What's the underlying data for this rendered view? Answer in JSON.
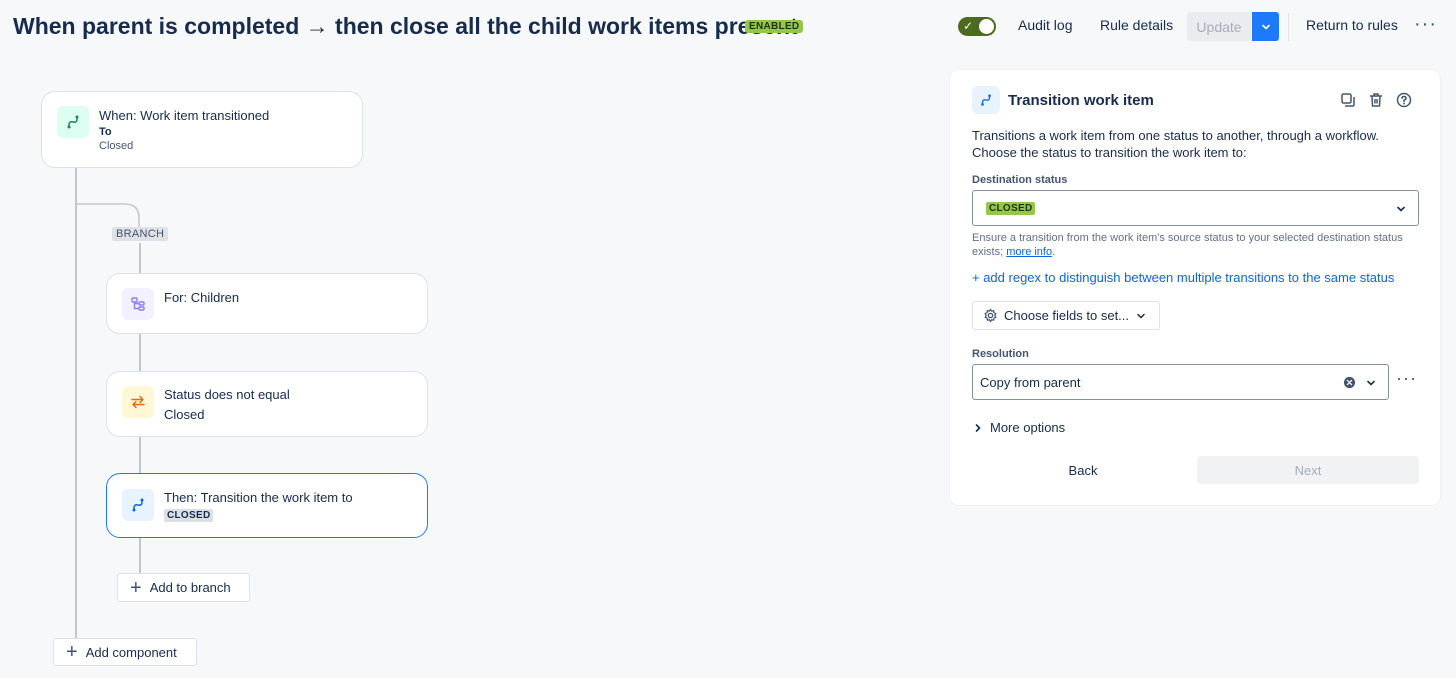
{
  "header": {
    "title": "When parent is completed → then close all the child work items present",
    "status_badge": "ENABLED",
    "audit_log": "Audit log",
    "rule_details": "Rule details",
    "update": "Update",
    "return_to_rules": "Return to rules",
    "toggle_on": true
  },
  "canvas": {
    "trigger": {
      "title": "When: Work item transitioned",
      "to_label": "To",
      "to_value": "Closed"
    },
    "branch_label": "BRANCH",
    "branch_card": {
      "title": "For: Children"
    },
    "condition_card": {
      "line1": "Status does not equal",
      "line2": "Closed"
    },
    "action_card": {
      "title": "Then: Transition the work item to",
      "status": "CLOSED"
    },
    "add_to_branch": "Add to branch",
    "add_component": "Add component"
  },
  "panel": {
    "title": "Transition work item",
    "description": "Transitions a work item from one status to another, through a workflow. Choose the status to transition the work item to:",
    "destination_label": "Destination status",
    "destination_value": "CLOSED",
    "help_text": "Ensure a transition from the work item's source status to your selected destination status exists;",
    "help_link": "more info",
    "help_end": ".",
    "add_regex": "+ add regex to distinguish between multiple transitions to the same status",
    "choose_fields": "Choose fields to set...",
    "resolution_label": "Resolution",
    "resolution_value": "Copy from parent",
    "more_options": "More options",
    "back": "Back",
    "next": "Next"
  },
  "colors": {
    "accent": "#1d7afc",
    "enabled": "#94c748",
    "link": "#0c66e4"
  },
  "icons": [
    "transition-icon",
    "children-icon",
    "condition-icon",
    "copy-icon",
    "trash-icon",
    "help-icon",
    "gear-icon",
    "chevron-down-icon",
    "chevron-right-icon",
    "clear-icon",
    "more-icon",
    "plus-icon",
    "check-icon"
  ]
}
